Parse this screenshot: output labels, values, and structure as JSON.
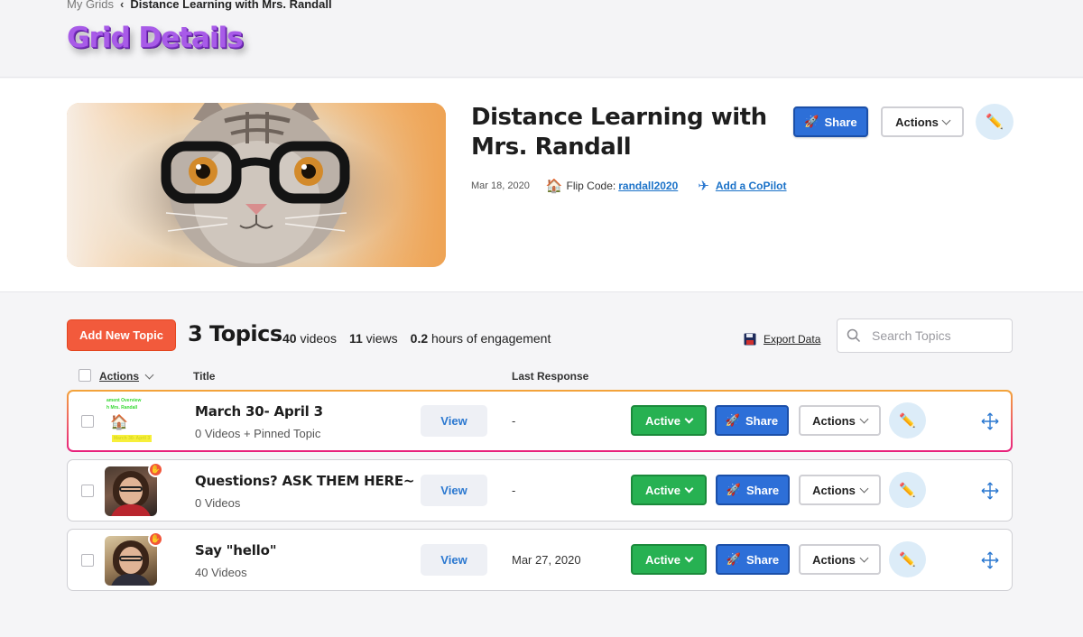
{
  "breadcrumb": {
    "root": "My Grids",
    "current": "Distance Learning with Mrs. Randall"
  },
  "page_title": "Grid Details",
  "grid": {
    "title": "Distance Learning with Mrs. Randall",
    "date": "Mar 18, 2020",
    "flip_code_label": "Flip Code:",
    "flip_code": "randall2020",
    "copilot_label": "Add a CoPilot",
    "share_label": "Share",
    "actions_label": "Actions"
  },
  "toolbar": {
    "add_topic_label": "Add New Topic",
    "topics_count": "3 Topics",
    "videos_num": "40",
    "videos_label": "videos",
    "views_num": "11",
    "views_label": "views",
    "hours_num": "0.2",
    "hours_label": "hours of engagement",
    "export_label": "Export Data",
    "search_placeholder": "Search Topics"
  },
  "columns": {
    "actions": "Actions",
    "title": "Title",
    "last_response": "Last Response"
  },
  "topics": [
    {
      "title": "March 30- April 3",
      "subtitle": "0 Videos + Pinned Topic",
      "last_response": "-",
      "view_label": "View",
      "status": "Active",
      "share_label": "Share",
      "actions_label": "Actions",
      "thumb_line1": "ament Overview",
      "thumb_line2": "h Mrs. Randall",
      "thumb_line3": "March 30- April 3"
    },
    {
      "title": "Questions? ASK THEM HERE~",
      "subtitle": "0 Videos",
      "last_response": "-",
      "view_label": "View",
      "status": "Active",
      "share_label": "Share",
      "actions_label": "Actions"
    },
    {
      "title": "Say \"hello\"",
      "subtitle": "40 Videos",
      "last_response": "Mar 27, 2020",
      "view_label": "View",
      "status": "Active",
      "share_label": "Share",
      "actions_label": "Actions"
    }
  ],
  "colors": {
    "title_purple": "#a85be8",
    "add_topic": "#f25a3c",
    "share_blue": "#2d6fd8",
    "active_green": "#27b152",
    "link_blue": "#1b72c8"
  },
  "icons": [
    "chevron-left-icon",
    "house-icon",
    "airplane-icon",
    "rocket-icon",
    "pencil-icon",
    "search-icon",
    "floppy-disk-icon",
    "move-arrows-icon",
    "hand-icon",
    "chevron-down-icon"
  ]
}
